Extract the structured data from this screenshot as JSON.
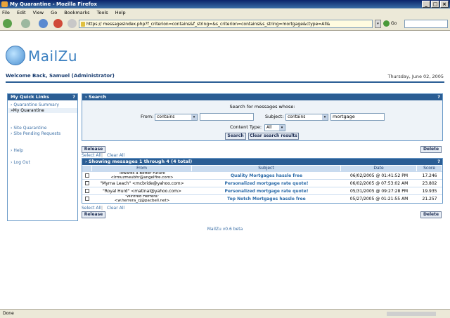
{
  "window": {
    "title": "My Quarantine - Mozilla Firefox"
  },
  "menu": [
    "File",
    "Edit",
    "View",
    "Go",
    "Bookmarks",
    "Tools",
    "Help"
  ],
  "url": "https://                          messagesIndex.php?f_criterion=contains&f_string=&s_criterion=contains&s_string=mortgage&ctype=All&",
  "go_label": "Go",
  "logo": "MailZu",
  "welcome": "Welcome Back, Samuel (Administrator)",
  "date": "Thursday, June 02, 2005",
  "quicklinks": {
    "title": "My Quick Links",
    "help": "?",
    "items": [
      "Quarantine Summary",
      "My Quarantine",
      "Site Quarantine",
      "Site Pending Requests",
      "Help",
      "Log Out"
    ]
  },
  "search": {
    "title": "Search",
    "help": "?",
    "subtitle": "Search for messages whose:",
    "from_label": "From:",
    "from_criterion": "contains",
    "from_value": "",
    "subject_label": "Subject:",
    "subject_criterion": "contains",
    "subject_value": "mortgage",
    "content_label": "Content Type:",
    "content_value": "All",
    "search_btn": "Search",
    "clear_btn": "Clear search results"
  },
  "actions": {
    "release": "Release",
    "delete": "Delete",
    "select_all": "Select All",
    "clear_all": "Clear All"
  },
  "table": {
    "title": "Showing messages 1 through 4    (4 total)",
    "help": "?",
    "headers": [
      "From",
      "Subject",
      "Date",
      "Score"
    ],
    "rows": [
      {
        "from1": "Towards a Better Future",
        "from2": "<lrmuzmeubhr@angelfire.com>",
        "subject": "Quality Mortgages hassle free",
        "date": "06/02/2005 @ 01:41:52 PM",
        "score": "17.246"
      },
      {
        "from1": "\"Myrna Leach\" <mcbride@yahoo.com>",
        "from2": "",
        "subject": "Personalized mortgage rate quote!",
        "date": "06/02/2005 @ 07:53:02 AM",
        "score": "23.802"
      },
      {
        "from1": "\"Royal Hurd\" <matinal@yahoo.com>",
        "from2": "",
        "subject": "Personalized mortgage rate quote!",
        "date": "05/31/2005 @ 09:27:28 PM",
        "score": "19.935"
      },
      {
        "from1": "\"Winfred Herrera\"",
        "from2": "<w.herrera_cj@pacbell.net>",
        "subject": "Top Notch Mortgages hassle free",
        "date": "05/27/2005 @ 01:21:55 AM",
        "score": "21.257"
      }
    ]
  },
  "footer": "MailZu v0.6 beta",
  "status": "Done"
}
